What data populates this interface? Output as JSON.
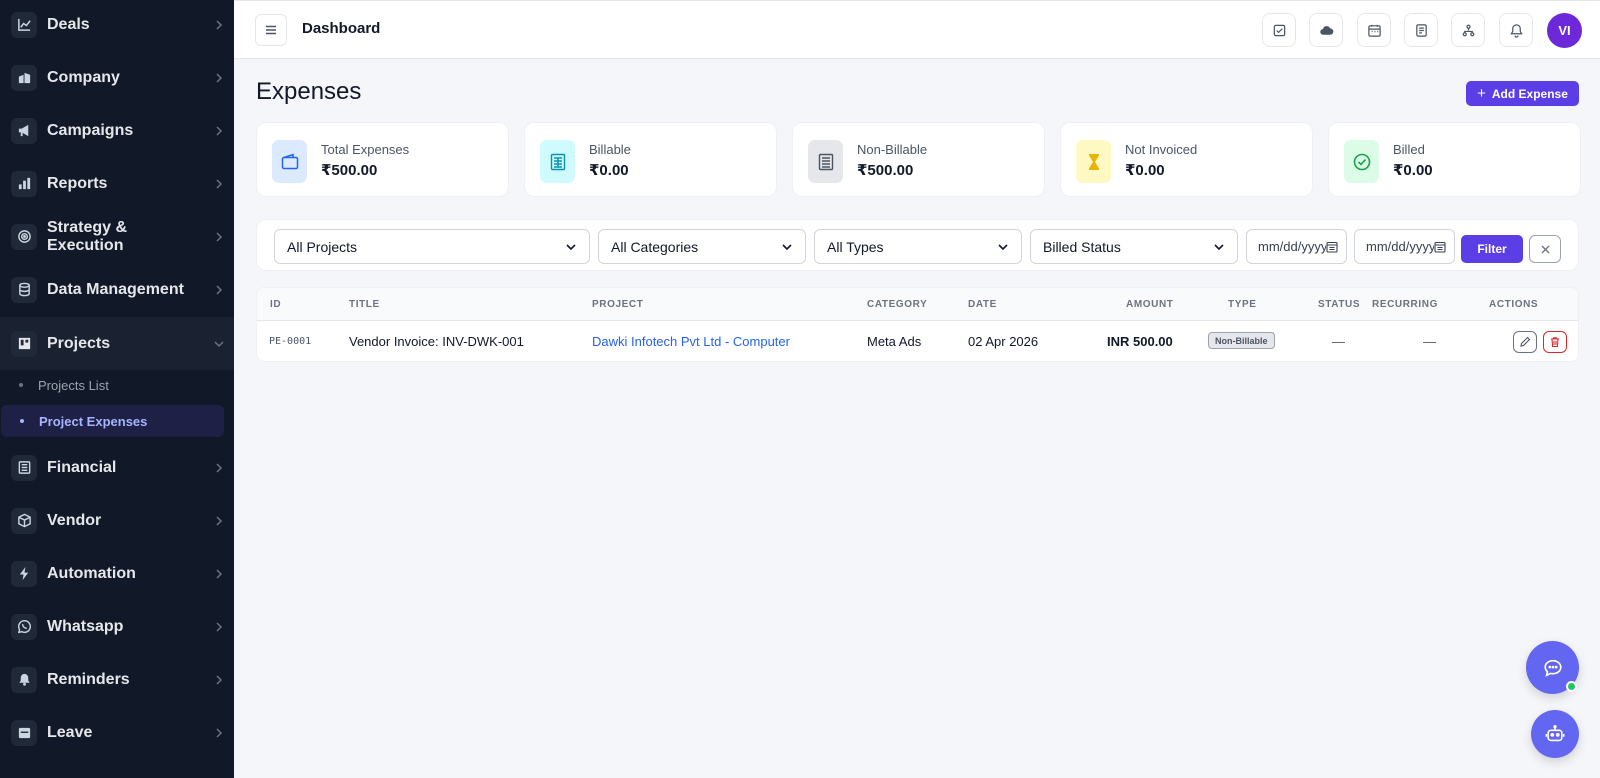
{
  "sidebar": {
    "items": [
      {
        "label": "Deals",
        "icon": "chart-line-icon"
      },
      {
        "label": "Company",
        "icon": "building-icon"
      },
      {
        "label": "Campaigns",
        "icon": "megaphone-icon"
      },
      {
        "label": "Reports",
        "icon": "bar-chart-icon"
      },
      {
        "label": "Strategy & Execution",
        "icon": "target-icon"
      },
      {
        "label": "Data Management",
        "icon": "database-icon"
      },
      {
        "label": "Projects",
        "icon": "projects-icon"
      },
      {
        "label": "Financial",
        "icon": "ledger-icon"
      },
      {
        "label": "Vendor",
        "icon": "box-icon"
      },
      {
        "label": "Automation",
        "icon": "bolt-icon"
      },
      {
        "label": "Whatsapp",
        "icon": "whatsapp-icon"
      },
      {
        "label": "Reminders",
        "icon": "bell-icon"
      },
      {
        "label": "Leave",
        "icon": "calendar-icon"
      }
    ],
    "sub_items": [
      {
        "label": "Projects List"
      },
      {
        "label": "Project Expenses"
      }
    ]
  },
  "topbar": {
    "title": "Dashboard",
    "avatar_initials": "VI"
  },
  "page": {
    "title": "Expenses",
    "add_button_label": "Add Expense"
  },
  "cards": [
    {
      "label": "Total Expenses",
      "value": "₹500.00",
      "accent": "#2563eb"
    },
    {
      "label": "Billable",
      "value": "₹0.00",
      "accent": "#06b6d4"
    },
    {
      "label": "Non-Billable",
      "value": "₹500.00",
      "accent": "#6b7280"
    },
    {
      "label": "Not Invoiced",
      "value": "₹0.00",
      "accent": "#eab308"
    },
    {
      "label": "Billed",
      "value": "₹0.00",
      "accent": "#16a34a"
    }
  ],
  "filters": {
    "projects": "All Projects",
    "categories": "All Categories",
    "types": "All Types",
    "billed_status": "Billed Status",
    "date_from_placeholder": "mm/dd/yyyy",
    "date_to_placeholder": "mm/dd/yyyy",
    "filter_label": "Filter"
  },
  "table": {
    "columns": [
      "ID",
      "TITLE",
      "PROJECT",
      "CATEGORY",
      "DATE",
      "AMOUNT",
      "TYPE",
      "STATUS",
      "RECURRING",
      "ACTIONS"
    ],
    "rows": [
      {
        "id": "PE-0001",
        "title": "Vendor Invoice: INV-DWK-001",
        "project": "Dawki Infotech Pvt Ltd - Computer",
        "category": "Meta Ads",
        "date": "02 Apr 2026",
        "amount": "INR 500.00",
        "type": "Non-Billable",
        "status": "—",
        "recurring": "—"
      }
    ]
  },
  "colors": {
    "primary": "#5b3ee6",
    "sidebar_bg": "#111827",
    "link": "#2563eb",
    "danger": "#dc2626",
    "online": "#22c55e"
  }
}
